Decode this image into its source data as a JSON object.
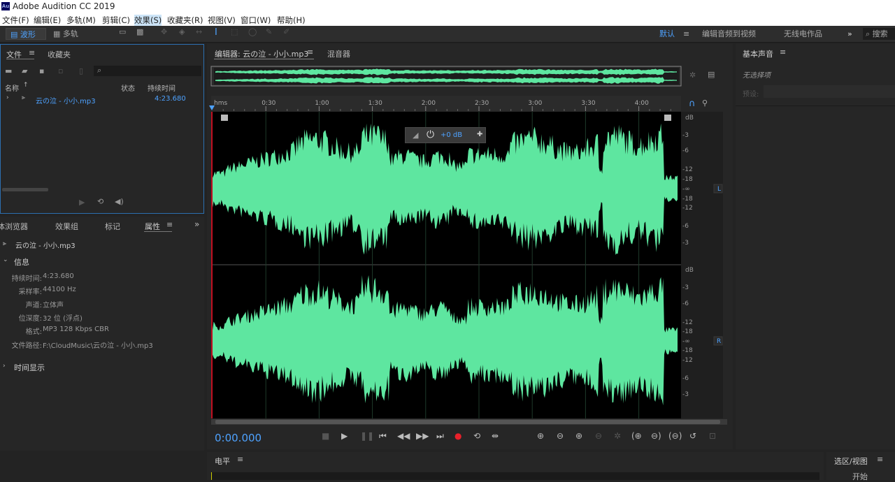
{
  "app": {
    "title": "Adobe Audition CC 2019",
    "logo": "Au"
  },
  "menu": [
    "文件(F)",
    "编辑(E)",
    "多轨(M)",
    "剪辑(C)",
    "效果(S)",
    "收藏夹(R)",
    "视图(V)",
    "窗口(W)",
    "帮助(H)"
  ],
  "toolbar": {
    "waveform": "波形",
    "multitrack": "多轨",
    "workspace_default": "默认",
    "workspace_edit_video": "编辑音频到视频",
    "workspace_radio": "无线电作品",
    "search": "搜索"
  },
  "files_panel": {
    "tab_files": "文件",
    "tab_favorites": "收藏夹",
    "col_name": "名称",
    "col_status": "状态",
    "col_duration": "持续时间",
    "file_name": "云の泣 - 小小.mp3",
    "file_duration": "4:23.680"
  },
  "props_panel": {
    "tabs": [
      "媒体浏览器",
      "效果组",
      "标记",
      "属性"
    ],
    "filename": "云の泣 - 小小.mp3",
    "section_info": "信息",
    "info": [
      {
        "k": "持续时间:",
        "v": "4:23.680"
      },
      {
        "k": "采样率:",
        "v": "44100 Hz"
      },
      {
        "k": "声道:",
        "v": "立体声"
      },
      {
        "k": "位深度:",
        "v": "32 位 (浮点)"
      },
      {
        "k": "格式:",
        "v": "MP3 128 Kbps CBR"
      },
      {
        "k": "文件路径:",
        "v": "F:\\CloudMusic\\云の泣 - 小小.mp3"
      }
    ],
    "section_time": "时间显示"
  },
  "editor": {
    "tab_editor": "编辑器: 云の泣 - 小小.mp3",
    "tab_mixer": "混音器",
    "hud_db": "+0 dB",
    "ruler": [
      "hms",
      "0:30",
      "1:00",
      "1:30",
      "2:00",
      "2:30",
      "3:00",
      "3:30",
      "4:00"
    ],
    "db_top": [
      "dB",
      "-3",
      "-6",
      "-12",
      "-18",
      "-∞",
      "-18",
      "-12",
      "-6",
      "-3"
    ],
    "db_bottom": [
      "dB",
      "-3",
      "-6",
      "-12",
      "-18",
      "-∞",
      "-18",
      "-12",
      "-6",
      "-3"
    ],
    "channel_L": "L",
    "channel_R": "R",
    "time": "0:00.000"
  },
  "essential_sound": {
    "title": "基本声音",
    "no_selection": "无选择项",
    "preset": "预设:"
  },
  "level_panel": {
    "title": "电平"
  },
  "selection_panel": {
    "title": "选区/视图",
    "start": "开始"
  },
  "colors": {
    "waveform": "#5ee6a0",
    "accent": "#4ea2ff",
    "record": "#e8202a"
  }
}
